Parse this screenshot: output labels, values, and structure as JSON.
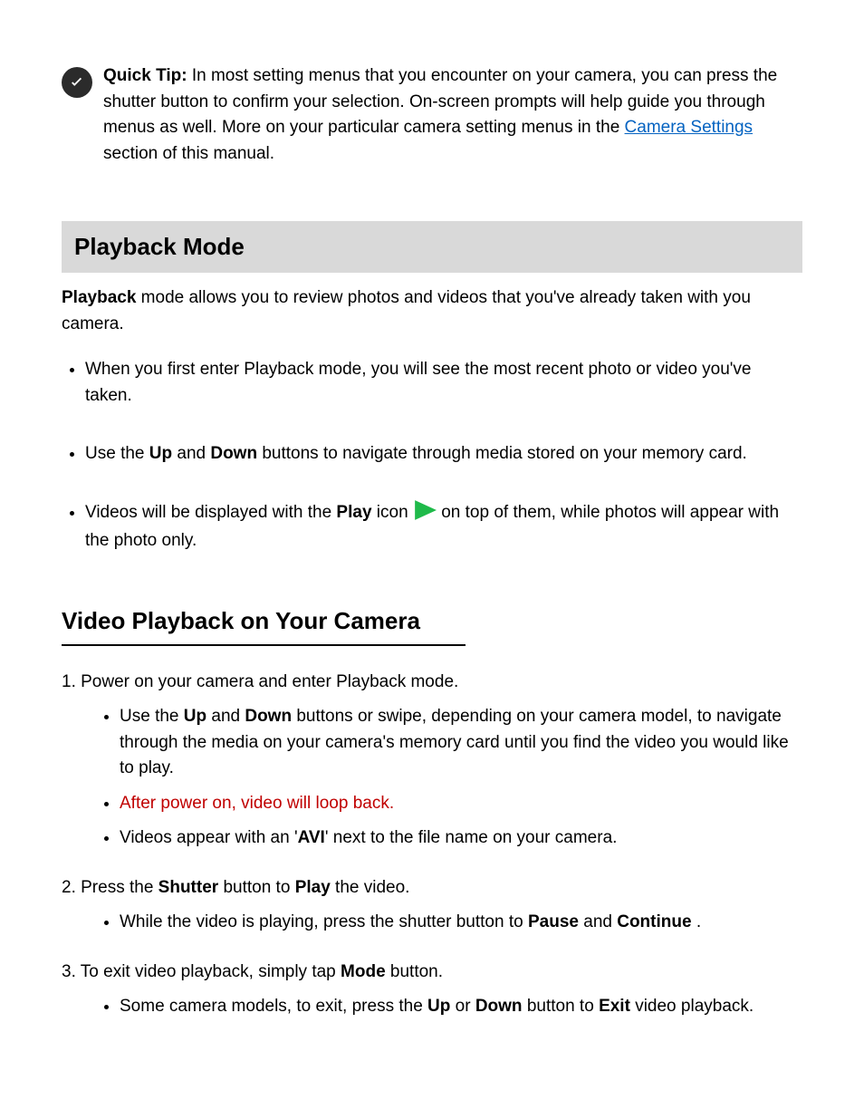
{
  "tip": {
    "label": "Quick Tip:",
    "body_1": " In most setting menus that you encounter on your camera, you can press the shutter button to confirm your selection. On-screen prompts will help guide you through menus as well. More on your particular camera setting menus in the ",
    "link_text": "Camera Settings",
    "body_2": " section of this manual."
  },
  "section_heading": "Playback Mode",
  "intro_1": "Playback ",
  "intro_2": "mode allows you to review photos and videos that you've already taken with you camera.",
  "bullets": {
    "b1": "When you first enter Playback mode, you will see the most recent photo or video you've taken.",
    "b2_a": "Use the ",
    "b2_b": "Up",
    "b2_c": " and ",
    "b2_d": "Down",
    "b2_e": " buttons to navigate through media stored on your memory card.",
    "b3_a": "Videos will be displayed with the ",
    "b3_b": "Play",
    "b3_c": " icon ",
    "b3_d": " on top of them, while photos will appear with the photo only."
  },
  "video_heading": "Video Playback on Your Camera",
  "steps": {
    "s1": "1. Power on your camera and enter Playback mode.",
    "s1_a_1": "Use the ",
    "s1_a_2": "Up",
    "s1_a_3": " and ",
    "s1_a_4": "Down",
    "s1_a_5": " buttons or swipe, depending on your camera model, to navigate through the media on your camera's memory card until you find the video you would like to play.",
    "s1_b_1": "After power on, video will loop back.",
    "s1_c_1": "Videos appear with an '",
    "s1_c_2": "AVI",
    "s1_c_3": "' next to the file name on your camera.",
    "s2_a": "2. Press the ",
    "s2_b": "Shutter",
    "s2_c": " button to ",
    "s2_d": "Play",
    "s2_e": " the video.",
    "s2_f_1": "While the video is playing, press the shutter button to ",
    "s2_f_2": "Pause",
    "s2_f_3": " and ",
    "s2_f_4": "Continue",
    "s2_f_5": " .",
    "s3_a": "3. To exit video playback, simply tap ",
    "s3_b": "Mode",
    "s3_c": " button.",
    "s3_d_1": "Some camera models, to exit, press the ",
    "s3_d_2": "Up",
    "s3_d_3": " or ",
    "s3_d_4": "Down",
    "s3_d_5": " button to ",
    "s3_d_6": "Exit",
    "s3_d_7": " video playback."
  }
}
